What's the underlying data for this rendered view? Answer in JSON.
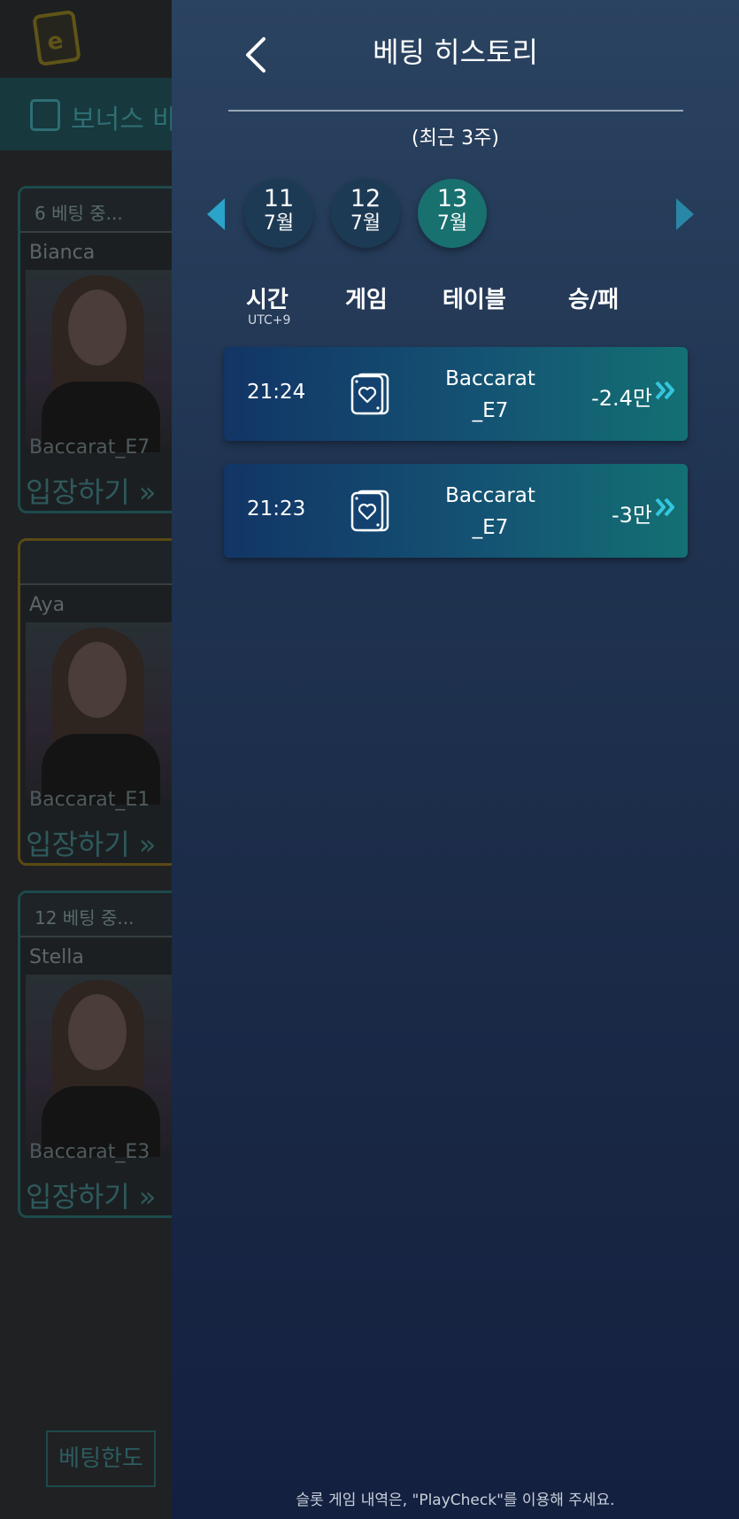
{
  "background": {
    "logo_letter": "e",
    "bonus_label": "보너스 바",
    "cards": [
      {
        "badge": "6   베팅 중...",
        "dealer": "Bianca",
        "table": "Baccarat_E7",
        "enter": "입장하기 »"
      },
      {
        "badge": "",
        "dealer": "Aya",
        "table": "Baccarat_E1",
        "enter": "입장하기 »"
      },
      {
        "badge": "12   베팅 중...",
        "dealer": "Stella",
        "table": "Baccarat_E3",
        "enter": "입장하기 »"
      }
    ],
    "limit_button": "베팅한도"
  },
  "drawer": {
    "title": "베팅 히스토리",
    "subtitle": "(최근 3주)",
    "dates": [
      {
        "day": "11",
        "month": "7월",
        "active": false
      },
      {
        "day": "12",
        "month": "7월",
        "active": false
      },
      {
        "day": "13",
        "month": "7월",
        "active": true
      }
    ],
    "columns": {
      "time": "시간",
      "timezone": "UTC+9",
      "game": "게임",
      "table": "테이블",
      "result": "승/패"
    },
    "rows": [
      {
        "time": "21:24",
        "game_icon": "card-heart-icon",
        "table_line1": "Baccarat",
        "table_line2": "_E7",
        "result": "-2.4만"
      },
      {
        "time": "21:23",
        "game_icon": "card-heart-icon",
        "table_line1": "Baccarat",
        "table_line2": "_E7",
        "result": "-3만"
      }
    ],
    "footer_note": "슬롯 게임 내역은, \"PlayCheck\"를 이용해 주세요."
  },
  "colors": {
    "accent": "#2aa4c8",
    "active_date": "#18706f",
    "chevron": "#35c6df"
  }
}
